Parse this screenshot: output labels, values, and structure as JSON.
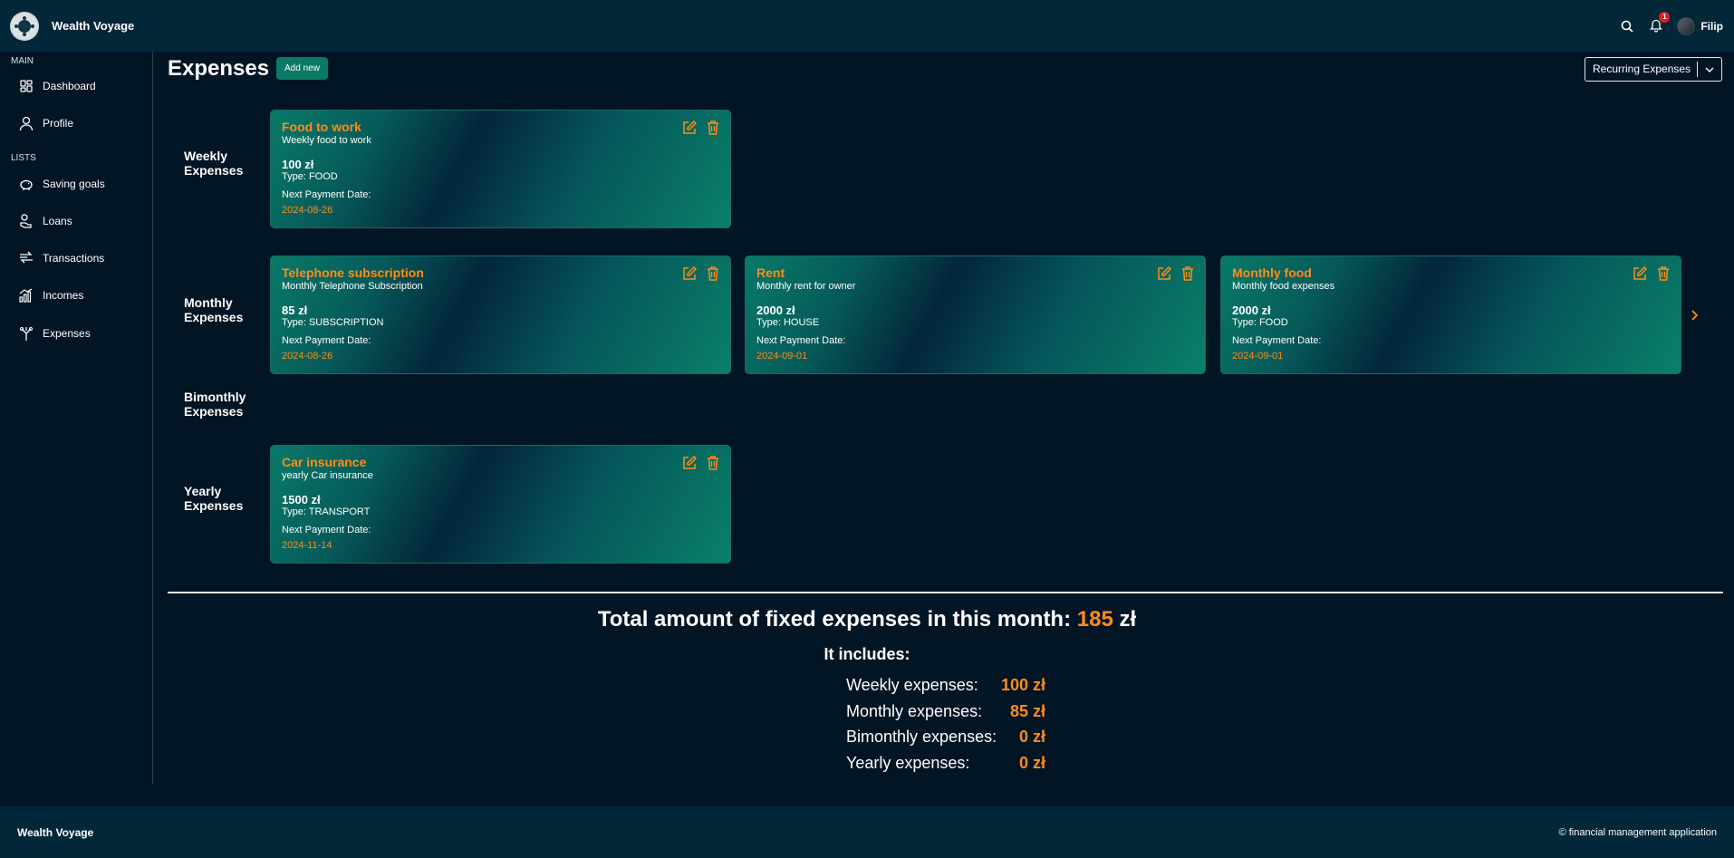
{
  "header": {
    "brand": "Wealth Voyage",
    "notification_count": "1",
    "user_name": "Filip"
  },
  "sidebar": {
    "main_label": "MAIN",
    "lists_label": "LISTS",
    "items": [
      {
        "label": "Dashboard",
        "icon": "dashboard-icon"
      },
      {
        "label": "Profile",
        "icon": "user-icon"
      },
      {
        "label": "Saving goals",
        "icon": "piggy-bank-icon"
      },
      {
        "label": "Loans",
        "icon": "money-hand-icon"
      },
      {
        "label": "Transactions",
        "icon": "transfer-icon"
      },
      {
        "label": "Incomes",
        "icon": "chart-up-icon"
      },
      {
        "label": "Expenses",
        "icon": "expenses-icon"
      }
    ]
  },
  "main": {
    "title": "Expenses",
    "add_new": "Add new",
    "filter": "Recurring Expenses",
    "rows": {
      "weekly": "Weekly Expenses",
      "monthly": "Monthly Expenses",
      "bimonthly": "Bimonthly Expenses",
      "yearly": "Yearly Expenses"
    },
    "next_payment_label": "Next Payment Date:",
    "cards": [
      {
        "title": "Food to work",
        "description": "Weekly food to work",
        "amount": "100 zł",
        "type": "Type: FOOD",
        "date": "2024-08-26"
      },
      {
        "title": "Telephone subscription",
        "description": "Monthly Telephone Subscription",
        "amount": "85 zł",
        "type": "Type: SUBSCRIPTION",
        "date": "2024-08-26"
      },
      {
        "title": "Rent",
        "description": "Monthly rent for owner",
        "amount": "2000 zł",
        "type": "Type: HOUSE",
        "date": "2024-09-01"
      },
      {
        "title": "Monthly food",
        "description": "Monthly food expenses",
        "amount": "2000 zł",
        "type": "Type: FOOD",
        "date": "2024-09-01"
      },
      {
        "title": "Car insurance",
        "description": "yearly Car insurance",
        "amount": "1500 zł",
        "type": "Type: TRANSPORT",
        "date": "2024-11-14"
      }
    ]
  },
  "summary": {
    "total_label": "Total amount of fixed expenses in this month:",
    "total_value": "185",
    "currency": "zł",
    "includes": "It includes:",
    "breakdown": [
      {
        "label": "Weekly expenses:",
        "value": "100 zł"
      },
      {
        "label": "Monthly expenses:",
        "value": "85 zł"
      },
      {
        "label": "Bimonthly expenses:",
        "value": "0 zł"
      },
      {
        "label": "Yearly expenses:",
        "value": "0 zł"
      }
    ]
  },
  "footer": {
    "brand": "Wealth Voyage",
    "copyright": "© financial management application"
  },
  "colors": {
    "background": "#021524",
    "bar": "#022739",
    "accent_orange": "#ff8c1a",
    "accent_green": "#0a7a66"
  }
}
